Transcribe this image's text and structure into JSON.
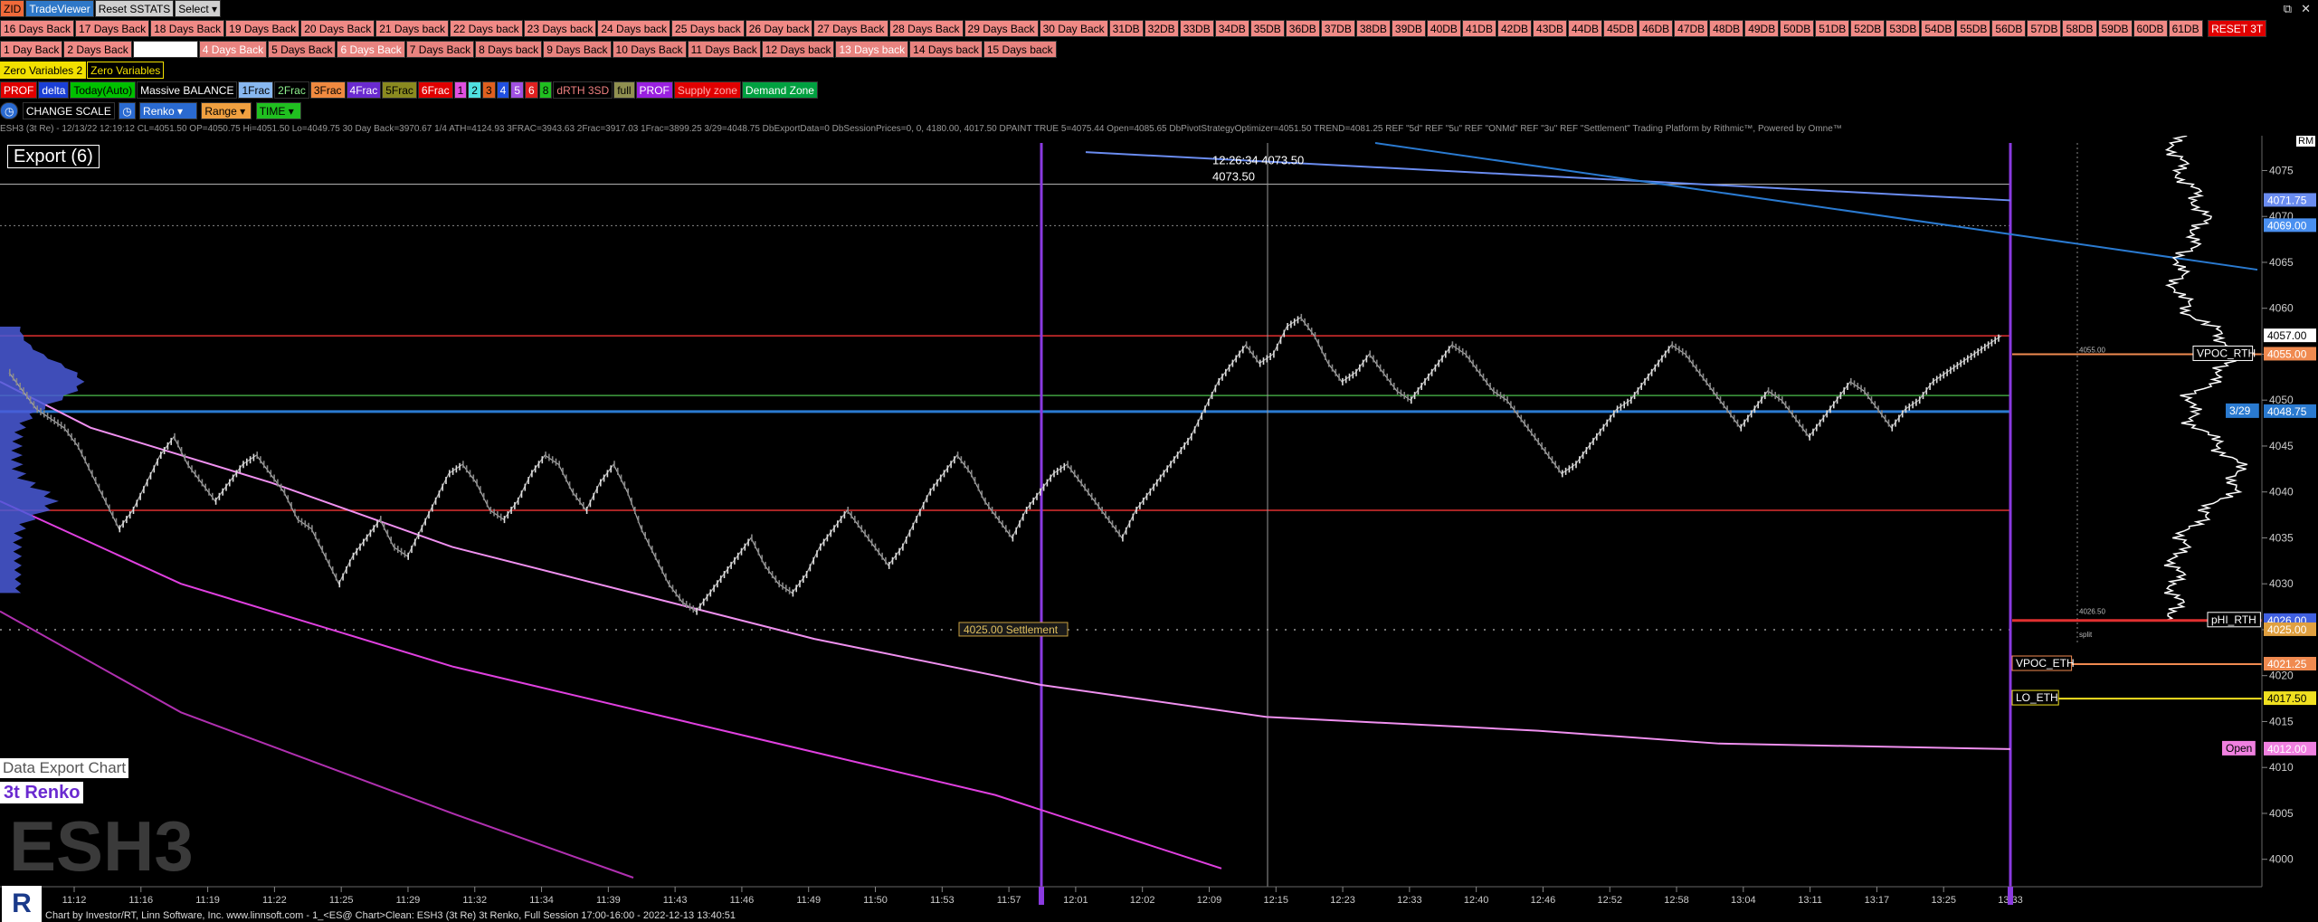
{
  "toolbar1": {
    "items": [
      {
        "label": "ZID",
        "bg": "#f06a3a",
        "fg": "#000"
      },
      {
        "label": "TradeViewer",
        "bg": "#2f78c8",
        "fg": "#fff"
      },
      {
        "label": "Reset SSTATS",
        "bg": "#d0d0d0",
        "fg": "#000"
      },
      {
        "label": "Select",
        "bg": "#d0d0d0",
        "fg": "#000",
        "dropdown": true
      }
    ]
  },
  "window_controls": {
    "restore": "⧉",
    "close": "✕"
  },
  "days_back_row1": [
    "16 Days Back",
    "17 Days Back",
    "18 Days Back",
    "19 Days Back",
    "20 Days Back",
    "21 Days back",
    "22 Days back",
    "23 Days back",
    "24 Days back",
    "25 Days back",
    "26 Day back",
    "27 Days Back",
    "28 Days Back",
    "29 Days Back",
    "30 Day Back",
    "31DB",
    "32DB",
    "33DB",
    "34DB",
    "35DB",
    "36DB",
    "37DB",
    "38DB",
    "39DB",
    "40DB",
    "41DB",
    "42DB",
    "43DB",
    "44DB",
    "45DB",
    "46DB",
    "47DB",
    "48DB",
    "49DB",
    "50DB",
    "51DB",
    "52DB",
    "53DB",
    "54DB",
    "55DB",
    "56DB",
    "57DB",
    "58DB",
    "59DB",
    "60DB",
    "61DB"
  ],
  "reset_3t": "RESET 3T",
  "days_back_row2": [
    "1 Day Back",
    "2 Days Back",
    "",
    "4 Days Back",
    "5 Days Back",
    "6 Days Back",
    "7 Days Back",
    "8 Days back",
    "9 Days Back",
    "10 Days Back",
    "11 Days Back",
    "12 Days back",
    "13 Days back",
    "14 Days back",
    "15 Days back"
  ],
  "zero_vars": [
    {
      "label": "Zero Variables 2",
      "bg": "#f2e000",
      "fg": "#000"
    },
    {
      "label": "Zero Variables",
      "bg": "#000",
      "fg": "#f2e000"
    }
  ],
  "study_row": [
    {
      "label": "PROF",
      "bg": "#e00000",
      "fg": "#fff"
    },
    {
      "label": "delta",
      "bg": "#1a3fd6",
      "fg": "#fff"
    },
    {
      "label": "Today(Auto)",
      "bg": "#00c000",
      "fg": "#000"
    },
    {
      "label": "Massive BALANCE",
      "bg": "#000",
      "fg": "#fff"
    },
    {
      "label": "1Frac",
      "bg": "#88b8f0",
      "fg": "#000"
    },
    {
      "label": "2Frac",
      "bg": "#000",
      "fg": "#8ef08e"
    },
    {
      "label": "3Frac",
      "bg": "#f08a40",
      "fg": "#000"
    },
    {
      "label": "4Frac",
      "bg": "#6a2ad0",
      "fg": "#fff"
    },
    {
      "label": "5Frac",
      "bg": "#8a8a20",
      "fg": "#000"
    },
    {
      "label": "6Frac",
      "bg": "#e00000",
      "fg": "#fff"
    },
    {
      "label": "1",
      "bg": "#e050e0",
      "fg": "#000"
    },
    {
      "label": "2",
      "bg": "#50e0e0",
      "fg": "#000"
    },
    {
      "label": "3",
      "bg": "#e06020",
      "fg": "#000"
    },
    {
      "label": "4",
      "bg": "#2050e0",
      "fg": "#fff"
    },
    {
      "label": "5",
      "bg": "#a050e0",
      "fg": "#fff"
    },
    {
      "label": "6",
      "bg": "#e02020",
      "fg": "#fff"
    },
    {
      "label": "8",
      "bg": "#20c020",
      "fg": "#000"
    },
    {
      "label": "dRTH 3SD",
      "bg": "#000",
      "fg": "#f08080"
    },
    {
      "label": "full",
      "bg": "#909050",
      "fg": "#000"
    },
    {
      "label": "PROF",
      "bg": "#9a20e0",
      "fg": "#fff"
    },
    {
      "label": "Supply zone",
      "bg": "#e00000",
      "fg": "#ffb0b0"
    },
    {
      "label": "Demand Zone",
      "bg": "#00a040",
      "fg": "#fff"
    }
  ],
  "scale_row": {
    "clock": "◷",
    "change_scale": "CHANGE SCALE",
    "chart_type": "Renko",
    "range": "Range",
    "time": "TIME"
  },
  "info_line": "ESH3 (3t Re) - 12/13/22 12:19:12 CL=4051.50 OP=4050.75 Hi=4051.50 Lo=4049.75    30 Day Back=3970.67    1/4 ATH=4124.93    3FRAC=3943.63    2Frac=3917.03    1Frac=3899.25    3/29=4048.75 DbExportData=0 DbSessionPrices=0, 0, 4180.00, 4017.50 DPAINT TRUE    5=4075.44    Open=4085.65 DbPivotStrategyOptimizer=4051.50    TREND=4081.25 REF \"5d\"  REF \"5u\"  REF \"ONMd\"  REF \"3u\"  REF \"Settlement\"  Trading Platform by Rithmic™, Powered by Omne™",
  "export_label": "Export (6)",
  "rm_label": "RM",
  "crosshair": {
    "time_price": "12:26:34   4073.50",
    "price": "4073.50"
  },
  "settlement_label": "4025.00 Settlement",
  "data_export_label": "Data Export Chart",
  "renko_label": "3t Renko",
  "watermark": "ESH3",
  "left_logo": "R",
  "status_bar": "Chart by Investor/RT, Linn Software, Inc. www.linnsoft.com - 1_<ES@ Chart>Clean: ESH3 (3t Re) 3t Renko, Full Session 17:00-16:00 - 2022-12-13 13:40:51",
  "vp_small_labels": {
    "top": "4055.00",
    "bottom": "4026.50",
    "split": "split"
  },
  "axis": {
    "prices": [
      4075,
      4070,
      4065,
      4060,
      4055,
      4050,
      4045,
      4040,
      4035,
      4030,
      4025,
      4020,
      4015,
      4010,
      4005,
      4000
    ],
    "times": [
      "11:12",
      "11:16",
      "11:19",
      "11:22",
      "11:25",
      "11:29",
      "11:32",
      "11:34",
      "11:39",
      "11:43",
      "11:46",
      "11:49",
      "11:50",
      "11:53",
      "11:57",
      "12:01",
      "12:02",
      "12:09",
      "12:15",
      "12:23",
      "12:33",
      "12:40",
      "12:46",
      "12:52",
      "12:58",
      "13:04",
      "13:11",
      "13:17",
      "13:25",
      "13:33"
    ]
  },
  "chart_data": {
    "type": "renko",
    "instrument": "ESH3",
    "ylim": [
      3998,
      4078
    ],
    "last": 4057.0,
    "close_path": [
      4053,
      4051,
      4049,
      4048,
      4047,
      4045,
      4042,
      4039,
      4036,
      4038,
      4041,
      4044,
      4046,
      4043,
      4041,
      4039,
      4041,
      4043,
      4044,
      4042,
      4040,
      4037,
      4036,
      4033,
      4030,
      4033,
      4035,
      4037,
      4034,
      4033,
      4036,
      4039,
      4042,
      4043,
      4041,
      4038,
      4037,
      4039,
      4042,
      4044,
      4043,
      4040,
      4038,
      4041,
      4043,
      4040,
      4036,
      4033,
      4030,
      4028,
      4027,
      4029,
      4031,
      4033,
      4035,
      4032,
      4030,
      4029,
      4031,
      4034,
      4036,
      4038,
      4036,
      4034,
      4032,
      4034,
      4037,
      4040,
      4042,
      4044,
      4042,
      4039,
      4037,
      4035,
      4038,
      4040,
      4042,
      4043,
      4041,
      4039,
      4037,
      4035,
      4038,
      4040,
      4042,
      4044,
      4046,
      4049,
      4052,
      4054,
      4056,
      4054,
      4055,
      4058,
      4059,
      4057,
      4054,
      4052,
      4053,
      4055,
      4053,
      4051,
      4050,
      4052,
      4054,
      4056,
      4055,
      4053,
      4051,
      4050,
      4048,
      4046,
      4044,
      4042,
      4043,
      4045,
      4047,
      4049,
      4050,
      4052,
      4054,
      4056,
      4055,
      4053,
      4051,
      4049,
      4047,
      4049,
      4051,
      4050,
      4048,
      4046,
      4048,
      4050,
      4052,
      4051,
      4049,
      4047,
      4049,
      4050,
      4052,
      4053,
      4054,
      4055,
      4056,
      4057
    ],
    "levels": [
      {
        "label": "4071.75",
        "price": 4071.75,
        "color": "#6a8cf0"
      },
      {
        "label": "4069.00",
        "price": 4069.0,
        "color": "#4a90f0"
      },
      {
        "label": "4057.00",
        "price": 4057.0,
        "color": "#ffffff"
      },
      {
        "label": "4055.00",
        "price": 4055.0,
        "color": "#f08a50",
        "tag": "VPOC_RTH"
      },
      {
        "label": "4048.75",
        "price": 4048.75,
        "color": "#2a7ad0",
        "tag": "3/29"
      },
      {
        "label": "4026.00",
        "price": 4026.0,
        "color": "#4060e0",
        "tag": "pHI_RTH"
      },
      {
        "label": "4025.00",
        "price": 4025.0,
        "color": "#e0a040"
      },
      {
        "label": "4021.25",
        "price": 4021.25,
        "color": "#f08a50",
        "tag": "VPOC_ETH"
      },
      {
        "label": "4017.50",
        "price": 4017.5,
        "color": "#f0e020",
        "tag": "LO_ETH"
      },
      {
        "label": "4012.00",
        "price": 4012.0,
        "color": "#f080e0",
        "tag": "Open"
      }
    ]
  }
}
